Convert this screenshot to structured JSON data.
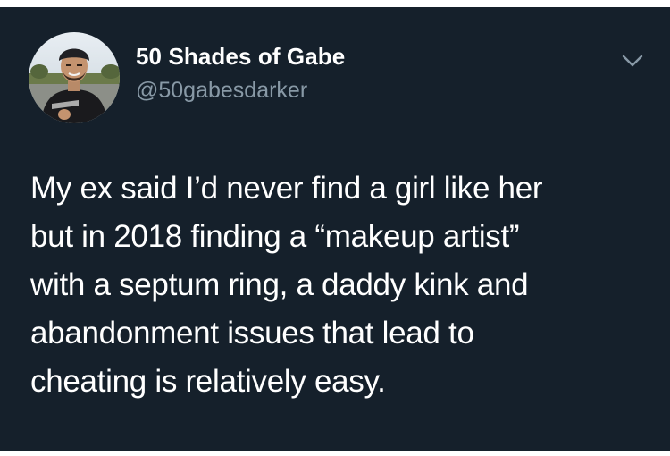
{
  "tweet": {
    "author": {
      "display_name": "50 Shades of Gabe",
      "handle": "@50gabesdarker",
      "avatar_icon": "profile-photo"
    },
    "menu_icon": "chevron-down-icon",
    "text_lines": [
      "My ex said I’d never find a girl like her",
      "but in 2018 finding a “makeup artist”",
      "with a septum ring, a daddy kink and",
      "abandonment issues that lead to",
      "cheating is relatively easy."
    ]
  },
  "colors": {
    "background": "#15202b",
    "text_primary": "#ffffff",
    "text_secondary": "#8899a6"
  }
}
